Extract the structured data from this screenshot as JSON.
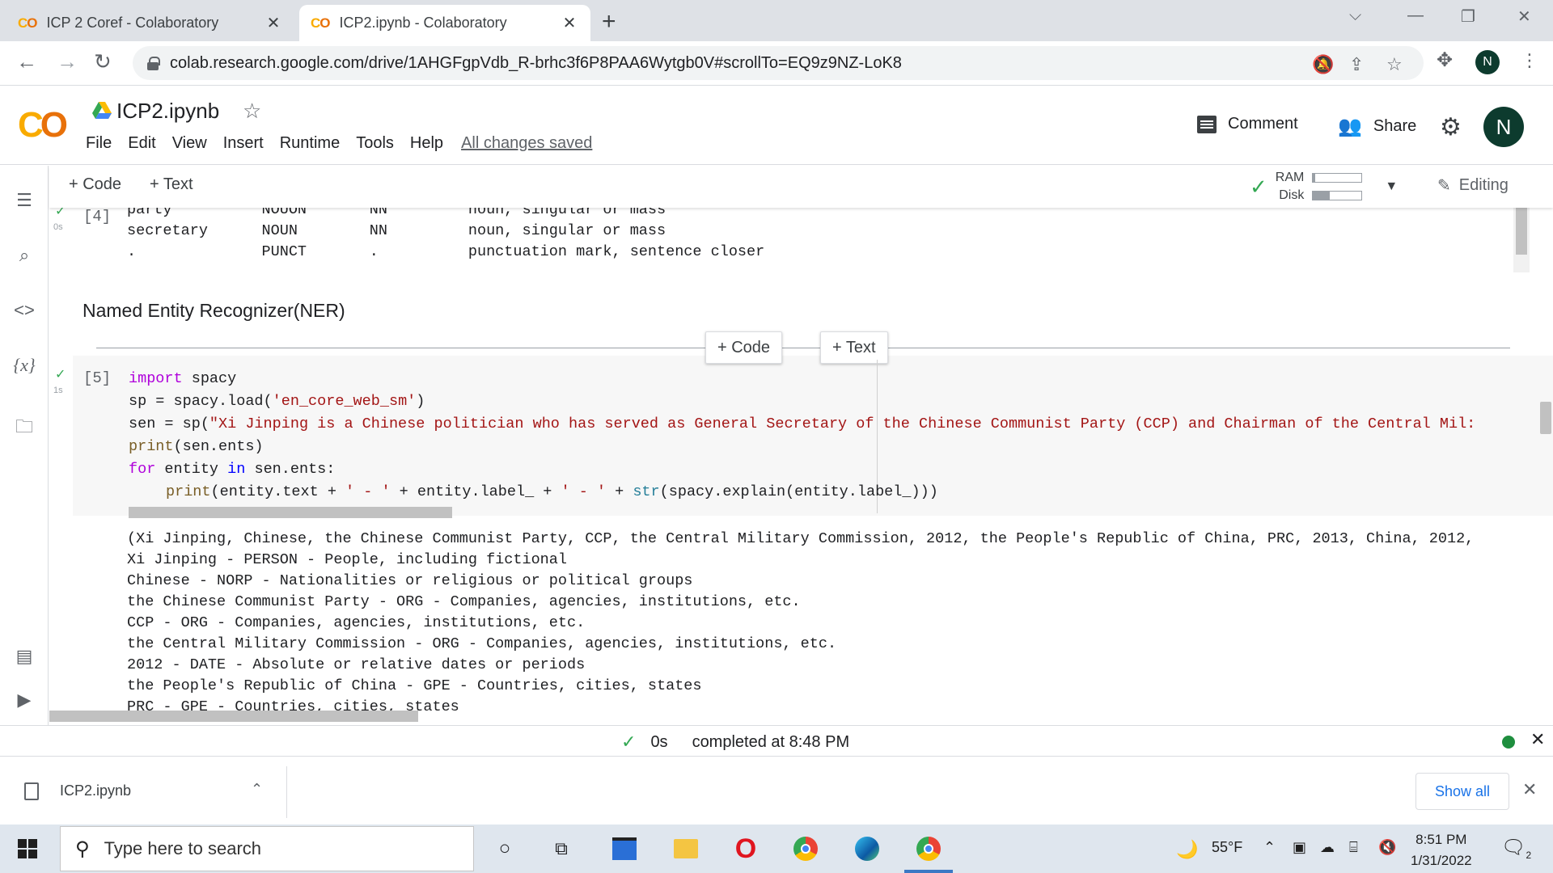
{
  "browser": {
    "tabs": [
      {
        "icon": "colab-logo-icon",
        "title": "ICP 2 Coref - Colaboratory"
      },
      {
        "icon": "colab-logo-icon",
        "title": "ICP2.ipynb - Colaboratory"
      }
    ],
    "url": "colab.research.google.com/drive/1AHGFgpVdb_R-brhc3f6P8PAA6Wytgb0V#scrollTo=EQ9z9NZ-LoK8",
    "profile_initial": "N"
  },
  "colab": {
    "notebook_title": "ICP2.ipynb",
    "menu": [
      "File",
      "Edit",
      "View",
      "Insert",
      "Runtime",
      "Tools",
      "Help"
    ],
    "save_status": "All changes saved",
    "comment_label": "Comment",
    "share_label": "Share",
    "profile_initial": "N"
  },
  "toolbar": {
    "add_code": "+ Code",
    "add_text": "+ Text",
    "ram_label": "RAM",
    "disk_label": "Disk",
    "ram_usage": 0.05,
    "disk_usage": 0.35,
    "editing_label": "Editing"
  },
  "cell4": {
    "number": "[4]",
    "exec_time": "0s",
    "output": [
      "party          NOUON       NN         noun, singular or mass",
      "secretary      NOUN        NN         noun, singular or mass",
      ".              PUNCT       .          punctuation mark, sentence closer"
    ]
  },
  "markdown": {
    "heading": "Named Entity Recognizer(NER)"
  },
  "insert": {
    "code": "+ Code",
    "text": "+ Text"
  },
  "cell5": {
    "number": "[5]",
    "exec_time": "1s",
    "code": {
      "l1_kw": "import",
      "l1_rest": " spacy",
      "l2_a": "sp = spacy.load(",
      "l2_str": "'en_core_web_sm'",
      "l2_b": ")",
      "l3_a": "sen = sp(",
      "l3_str": "\"Xi Jinping is a Chinese politician who has served as General Secretary of the Chinese Communist Party (CCP) and Chairman of the Central Mil:",
      "l4_fn": "print",
      "l4_rest": "(sen.ents)",
      "l5_for": "for",
      "l5_a": " entity ",
      "l5_in": "in",
      "l5_b": " sen.ents:",
      "l6_fn": "print",
      "l6_a": "(entity.text + ",
      "l6_s1": "' - '",
      "l6_b": " + entity.label_ + ",
      "l6_s2": "' - '",
      "l6_c": " + ",
      "l6_str": "str",
      "l6_d": "(spacy.explain(entity.label_)))"
    },
    "output": [
      "(Xi Jinping, Chinese, the Chinese Communist Party, CCP, the Central Military Commission, 2012, the People's Republic of China, PRC, 2013, China, 2012,",
      "Xi Jinping - PERSON - People, including fictional",
      "Chinese - NORP - Nationalities or religious or political groups",
      "the Chinese Communist Party - ORG - Companies, agencies, institutions, etc.",
      "CCP - ORG - Companies, agencies, institutions, etc.",
      "the Central Military Commission - ORG - Companies, agencies, institutions, etc.",
      "2012 - DATE - Absolute or relative dates or periods",
      "the People's Republic of China - GPE - Countries, cities, states",
      "PRC - GPE - Countries, cities, states"
    ]
  },
  "status": {
    "duration": "0s",
    "message": "completed at 8:48 PM"
  },
  "download": {
    "filename": "ICP2.ipynb",
    "show_all": "Show all"
  },
  "taskbar": {
    "search_placeholder": "Type here to search",
    "weather": "55°F",
    "time": "8:51 PM",
    "date": "1/31/2022",
    "notifications": "2"
  }
}
